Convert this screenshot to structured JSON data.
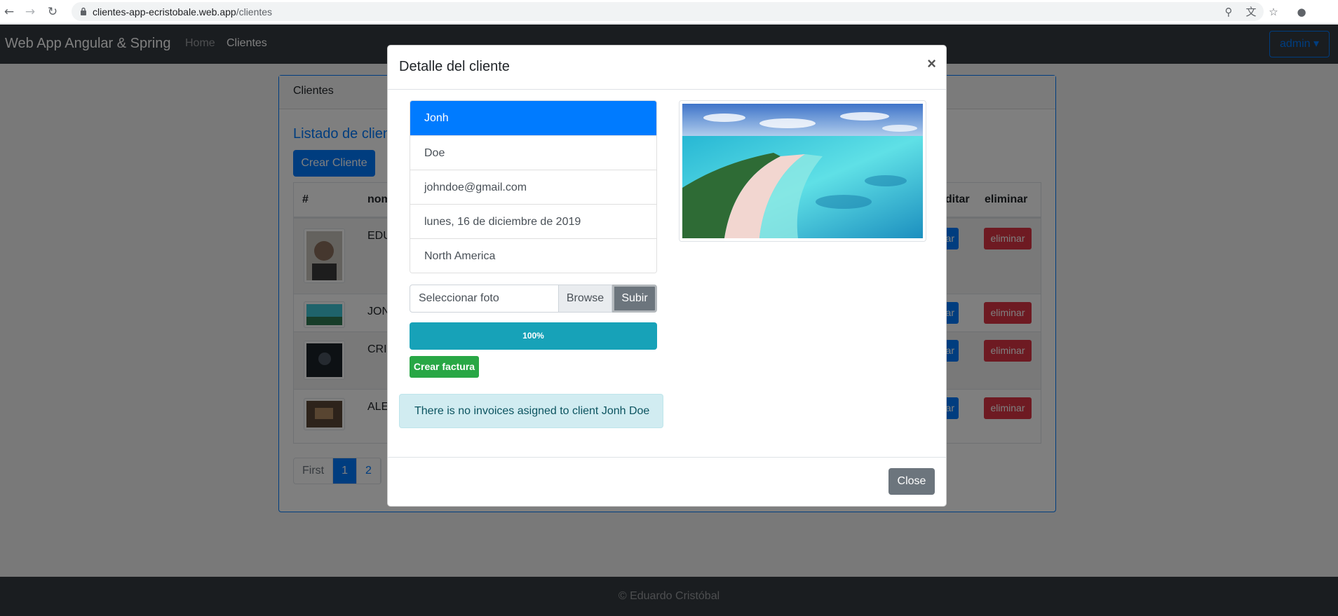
{
  "browser": {
    "url_domain": "clientes-app-ecristobale.web.app",
    "url_path": "/clientes",
    "icons": [
      "back-icon",
      "forward-icon",
      "reload-icon",
      "lock-icon",
      "key-icon",
      "translate-icon",
      "star-icon",
      "account-icon"
    ]
  },
  "app": {
    "brand": "Web App Angular & Spring",
    "nav": {
      "home": "Home",
      "clientes": "Clientes"
    },
    "user_menu": "admin ▾"
  },
  "card": {
    "header": "Clientes",
    "title": "Listado de clientes",
    "create_button": "Crear Cliente",
    "columns": {
      "index": "#",
      "name": "nombre",
      "edit": "editar",
      "delete": "eliminar"
    },
    "rows": [
      {
        "name": "EDU",
        "delete": "eliminar"
      },
      {
        "name": "JON",
        "delete": "eliminar"
      },
      {
        "name": "CRIS",
        "delete": "eliminar"
      },
      {
        "name": "ALE",
        "delete": "eliminar"
      }
    ],
    "pagination": {
      "first": "First",
      "pages": [
        "1",
        "2"
      ],
      "active": "1"
    }
  },
  "footer": "© Eduardo Cristóbal",
  "modal": {
    "title": "Detalle del cliente",
    "close_x": "×",
    "details": {
      "first_name": "Jonh",
      "last_name": "Doe",
      "email": "johndoe@gmail.com",
      "date": "lunes, 16 de diciembre de 2019",
      "region": "North America"
    },
    "upload": {
      "placeholder": "Seleccionar foto",
      "browse": "Browse",
      "submit": "Subir"
    },
    "progress": {
      "value": 100,
      "label": "100%"
    },
    "invoice_button": "Crear factura",
    "alert": "There is no invoices asigned to client Jonh Doe",
    "close_button": "Close"
  },
  "colors": {
    "primary": "#007bff",
    "danger": "#dc3545",
    "success": "#28a745",
    "info": "#17a2b8",
    "secondary": "#6c757d",
    "dark": "#343a40"
  }
}
